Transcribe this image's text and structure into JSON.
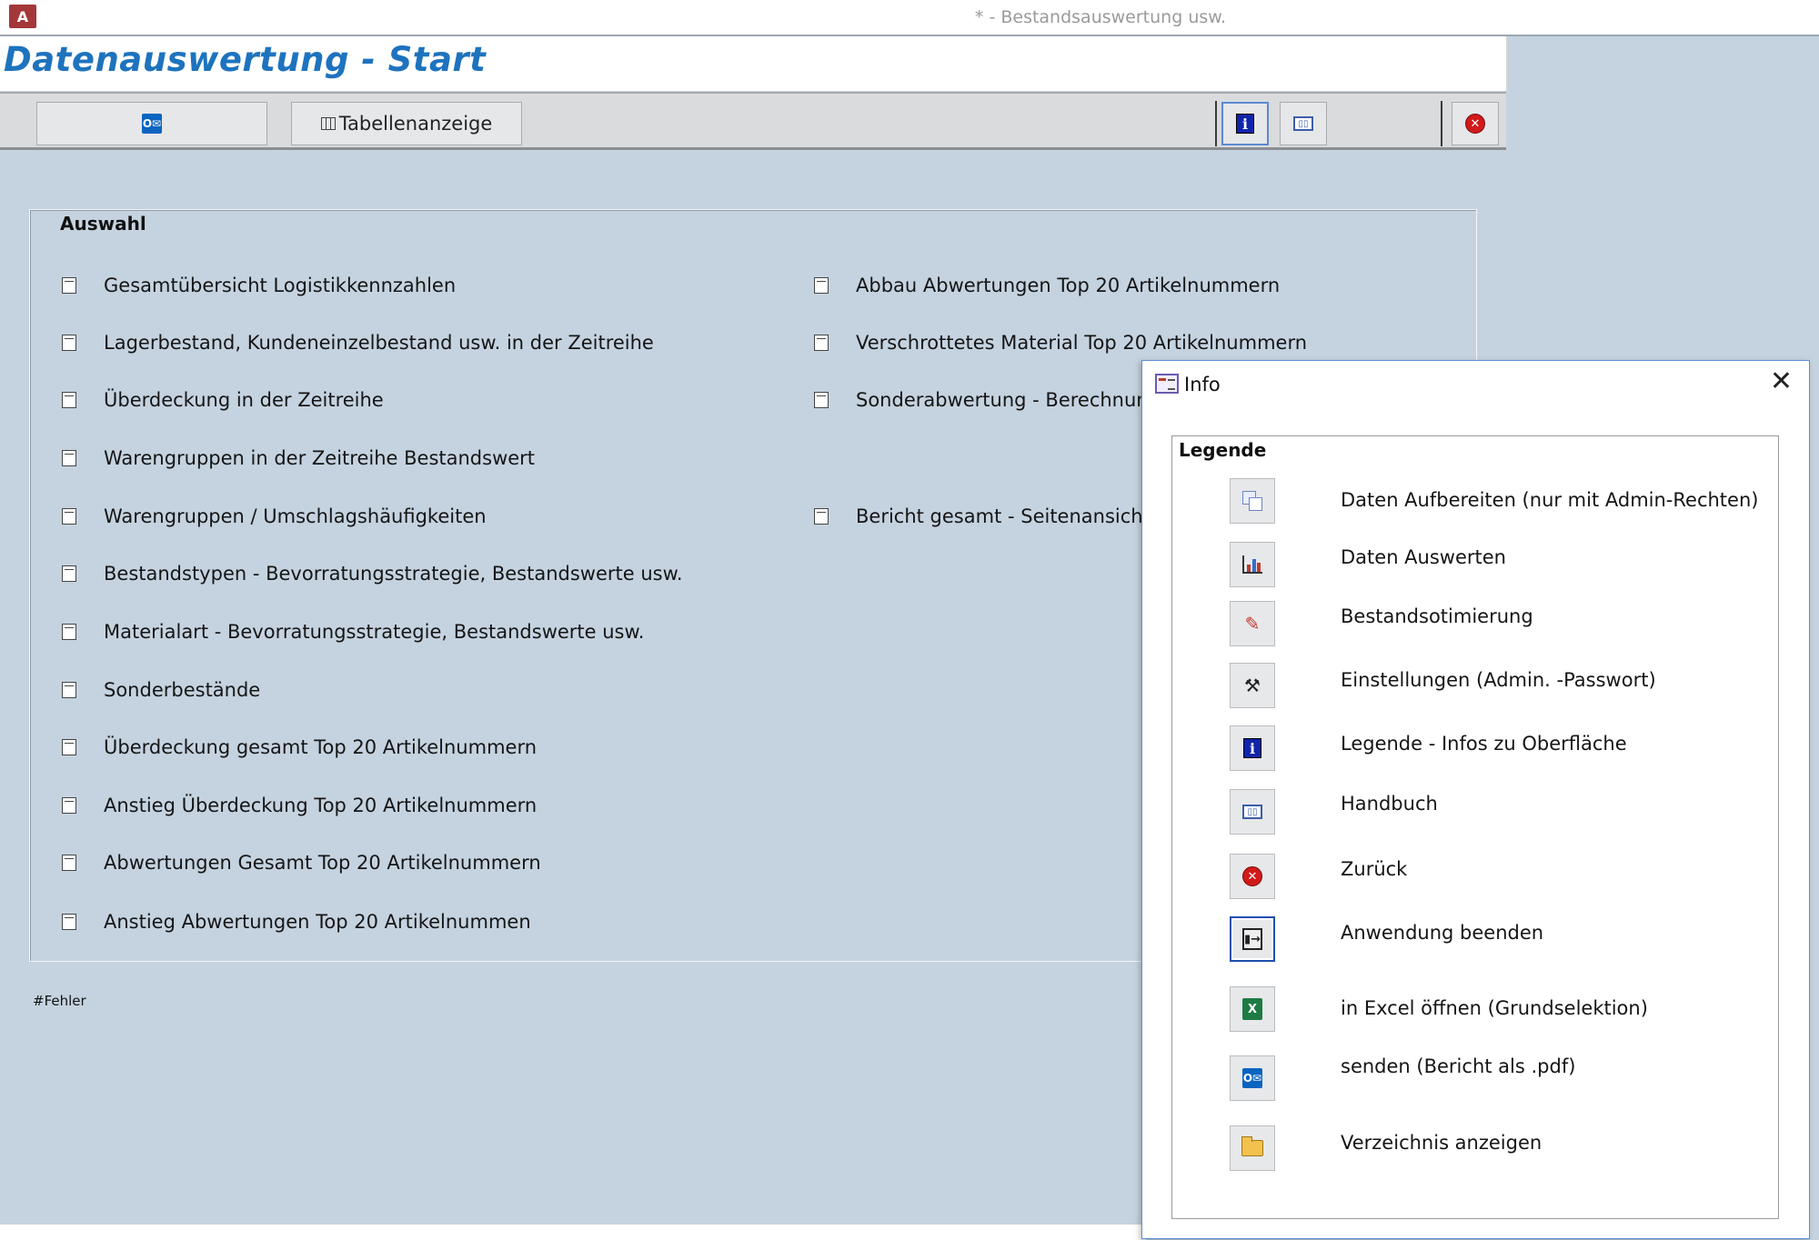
{
  "window": {
    "app_icon": "A",
    "title": "* - Bestandsauswertung usw."
  },
  "form": {
    "title": "Datenauswertung - Start"
  },
  "toolbar": {
    "send_icon": "outlook-icon",
    "table_view_label": "Tabellenanzeige",
    "info_icon": "info-icon",
    "manual_icon": "book-icon",
    "close_icon": "close-icon"
  },
  "selection": {
    "label": "Auswahl",
    "left_options": [
      "Gesamtübersicht Logistikkennzahlen",
      "Lagerbestand, Kundeneinzelbestand usw. in der Zeitreihe",
      "Überdeckung in der Zeitreihe",
      "Warengruppen in der Zeitreihe Bestandswert",
      "Warengruppen / Umschlagshäufigkeiten",
      "Bestandstypen - Bevorratungsstrategie, Bestandswerte usw.",
      "Materialart - Bevorratungsstrategie, Bestandswerte usw.",
      "Sonderbestände",
      "Überdeckung gesamt Top 20 Artikelnummern",
      "Anstieg Überdeckung Top 20 Artikelnummern",
      "Abwertungen Gesamt Top 20 Artikelnummern",
      "Anstieg Abwertungen Top 20 Artikelnummen"
    ],
    "right_options": [
      "Abbau Abwertungen Top 20 Artikelnummern",
      "Verschrottetes Material Top 20 Artikelnummern",
      "Sonderabwertung - Berechnung",
      "Bericht gesamt - Seitenansicht"
    ]
  },
  "error_text": "#Fehler",
  "info_dialog": {
    "title": "Info",
    "close_symbol": "✕",
    "legend_label": "Legende",
    "items": [
      {
        "icon": "prepare-data-icon",
        "label": "Daten Aufbereiten (nur mit Admin-Rechten)"
      },
      {
        "icon": "chart-icon",
        "label": "Daten Auswerten"
      },
      {
        "icon": "pencil-icon",
        "label": "Bestandsotimierung"
      },
      {
        "icon": "tools-icon",
        "label": "Einstellungen (Admin. -Passwort)"
      },
      {
        "icon": "info-icon",
        "label": "Legende - Infos zu Oberfläche"
      },
      {
        "icon": "book-icon",
        "label": "Handbuch"
      },
      {
        "icon": "close-icon",
        "label": "Zurück"
      },
      {
        "icon": "exit-icon",
        "label": "Anwendung beenden"
      },
      {
        "icon": "excel-icon",
        "label": "in Excel öffnen (Grundselektion)"
      },
      {
        "icon": "outlook-icon",
        "label": "senden (Bericht als .pdf)"
      },
      {
        "icon": "folder-icon",
        "label": "Verzeichnis anzeigen"
      }
    ]
  },
  "colors": {
    "form_background": "#c5d3e0",
    "title_blue": "#1e73be",
    "dialog_border": "#5b8fd6"
  }
}
